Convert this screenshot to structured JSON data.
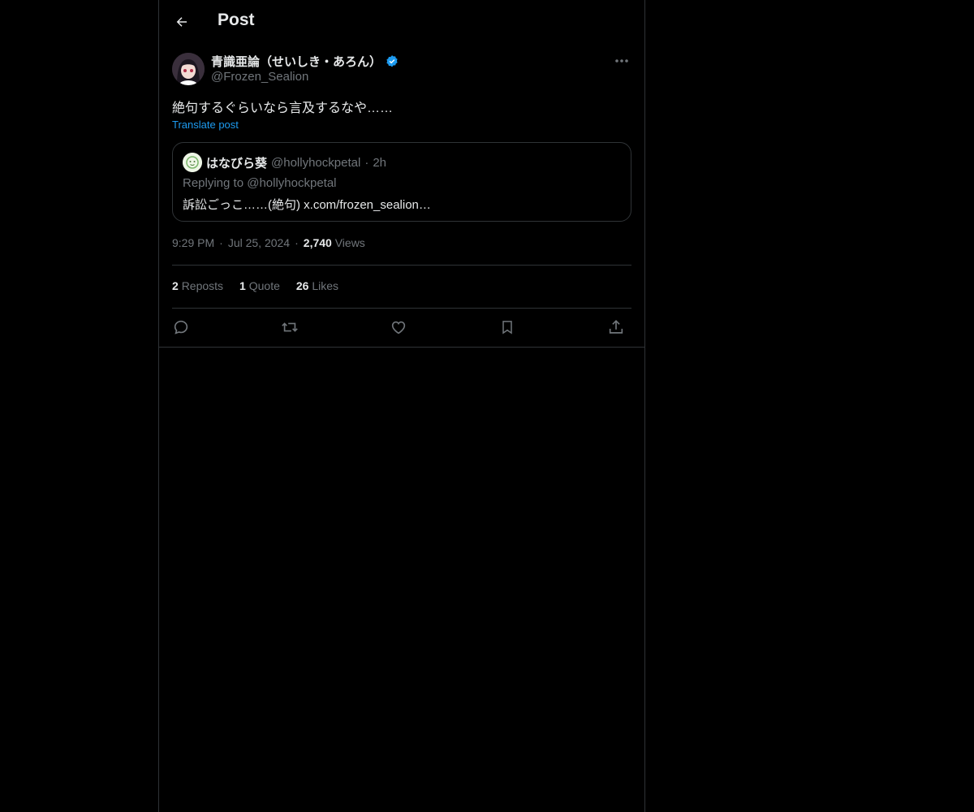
{
  "header": {
    "title": "Post",
    "back_icon": "arrow-left-icon"
  },
  "post": {
    "author": {
      "display_name": "青識亜論（せいしき・あろん）",
      "handle": "@Frozen_Sealion",
      "verified": true,
      "verified_color": "#1d9bf0"
    },
    "text": "絶句するぐらいなら言及するなや……",
    "translate_label": "Translate post",
    "quoted": {
      "display_name": "はなびら葵",
      "handle": "@hollyhockpetal",
      "separator": "·",
      "time": "2h",
      "replying_to": "Replying to @hollyhockpetal",
      "body": "訴訟ごっこ……(絶句) x.com/frozen_sealion…"
    },
    "meta": {
      "time": "9:29 PM",
      "date": "Jul 25, 2024",
      "views_count": "2,740",
      "views_label": "Views"
    },
    "stats": {
      "reposts_count": "2",
      "reposts_label": "Reposts",
      "quotes_count": "1",
      "quotes_label": "Quote",
      "likes_count": "26",
      "likes_label": "Likes"
    },
    "actions": [
      "reply-icon",
      "repost-icon",
      "like-icon",
      "bookmark-icon",
      "share-icon"
    ]
  },
  "colors": {
    "background": "#000000",
    "text": "#e7e9ea",
    "muted": "#71767b",
    "accent": "#1d9bf0",
    "border": "#2f3336"
  }
}
